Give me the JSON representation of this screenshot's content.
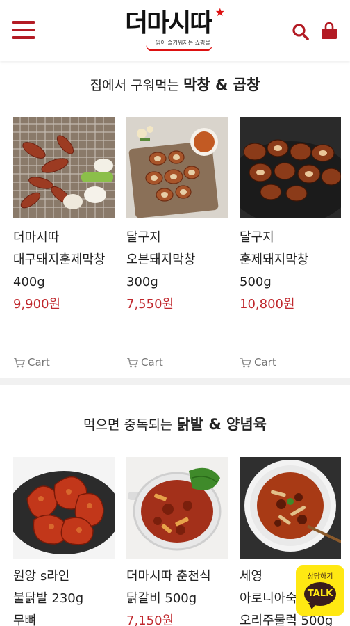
{
  "header": {
    "logo_text": "더마시따",
    "logo_slogan": "입이 즐거워지는 쇼핑몰"
  },
  "sections": [
    {
      "title_prefix": "집에서 구워먹는 ",
      "title_bold": "막창 & 곱창",
      "products": [
        {
          "brand": "더마시따",
          "name": "대구돼지훈제막창",
          "weight": "400g",
          "price": "9,900원",
          "cart_label": "Cart",
          "image": "grilled-makchang-photo"
        },
        {
          "brand": "달구지",
          "name": "오븐돼지막창",
          "weight": "300g",
          "price": "7,550원",
          "cart_label": "Cart",
          "image": "oven-makchang-photo"
        },
        {
          "brand": "달구지",
          "name": "훈제돼지막창",
          "weight": "500g",
          "price": "10,800원",
          "cart_label": "Cart",
          "image": "smoked-makchang-photo"
        }
      ]
    },
    {
      "title_prefix": "먹으면 중독되는 ",
      "title_bold": "닭발 & 양념육",
      "products": [
        {
          "line1": "원앙 s라인",
          "line2": "불닭발 230g",
          "line3": "무뼈",
          "price": "",
          "image": "spicy-chicken-feet-photo"
        },
        {
          "line1": "더마시따 춘천식",
          "line2": "닭갈비 500g",
          "line3": "",
          "price": "7,150원",
          "image": "dakgalbi-photo"
        },
        {
          "line1": "세영",
          "line2": "아로니아숙",
          "line3": "오리주물럭 500g",
          "price": "",
          "image": "duck-bulgogi-photo"
        }
      ]
    }
  ],
  "kakao": {
    "label": "상담하기",
    "bubble": "TALK"
  },
  "colors": {
    "accent": "#b31b24",
    "price": "#c0282d",
    "kakao_yellow": "#ffe812",
    "kakao_brown": "#3a1d1d"
  }
}
